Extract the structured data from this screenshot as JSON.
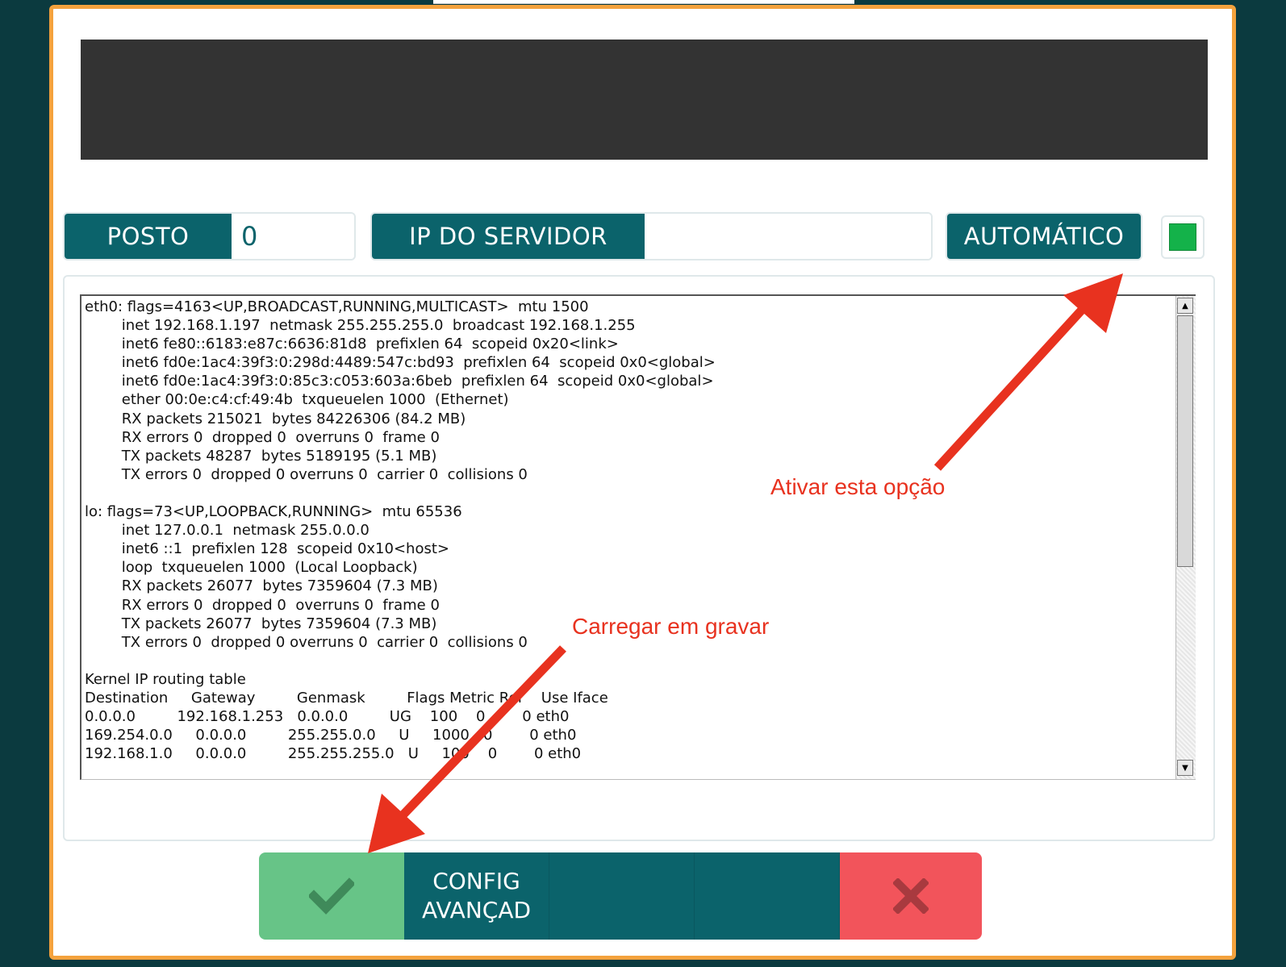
{
  "fields": {
    "posto_label": "POSTO",
    "posto_value": "0",
    "ip_label": "IP DO SERVIDOR",
    "ip_value": "",
    "auto_label": "AUTOMÁTICO",
    "auto_checked": true,
    "indicator_color": "#14b24a"
  },
  "console": {
    "lines": [
      "eth0: flags=4163<UP,BROADCAST,RUNNING,MULTICAST>  mtu 1500",
      "        inet 192.168.1.197  netmask 255.255.255.0  broadcast 192.168.1.255",
      "        inet6 fe80::6183:e87c:6636:81d8  prefixlen 64  scopeid 0x20<link>",
      "        inet6 fd0e:1ac4:39f3:0:298d:4489:547c:bd93  prefixlen 64  scopeid 0x0<global>",
      "        inet6 fd0e:1ac4:39f3:0:85c3:c053:603a:6beb  prefixlen 64  scopeid 0x0<global>",
      "        ether 00:0e:c4:cf:49:4b  txqueuelen 1000  (Ethernet)",
      "        RX packets 215021  bytes 84226306 (84.2 MB)",
      "        RX errors 0  dropped 0  overruns 0  frame 0",
      "        TX packets 48287  bytes 5189195 (5.1 MB)",
      "        TX errors 0  dropped 0 overruns 0  carrier 0  collisions 0",
      "",
      "lo: flags=73<UP,LOOPBACK,RUNNING>  mtu 65536",
      "        inet 127.0.0.1  netmask 255.0.0.0",
      "        inet6 ::1  prefixlen 128  scopeid 0x10<host>",
      "        loop  txqueuelen 1000  (Local Loopback)",
      "        RX packets 26077  bytes 7359604 (7.3 MB)",
      "        RX errors 0  dropped 0  overruns 0  frame 0",
      "        TX packets 26077  bytes 7359604 (7.3 MB)",
      "        TX errors 0  dropped 0 overruns 0  carrier 0  collisions 0",
      "",
      "Kernel IP routing table",
      "Destination     Gateway         Genmask         Flags Metric Ref    Use Iface",
      "0.0.0.0         192.168.1.253   0.0.0.0         UG    100    0        0 eth0",
      "169.254.0.0     0.0.0.0         255.255.0.0     U     1000   0        0 eth0",
      "192.168.1.0     0.0.0.0         255.255.255.0   U     100    0        0 eth0"
    ]
  },
  "buttons": {
    "ok_icon": "check-icon",
    "advanced_line1": "CONFIG",
    "advanced_line2": "AVANÇAD",
    "cancel_icon": "close-icon"
  },
  "annotations": {
    "activate": "Ativar esta opção",
    "save": "Carregar em gravar",
    "color": "#e8321f"
  },
  "colors": {
    "frame_border": "#f4a23d",
    "teal": "#0b636b",
    "ok_green": "#67c487",
    "cancel_red": "#f2545b",
    "background": "#0b3a3f"
  }
}
